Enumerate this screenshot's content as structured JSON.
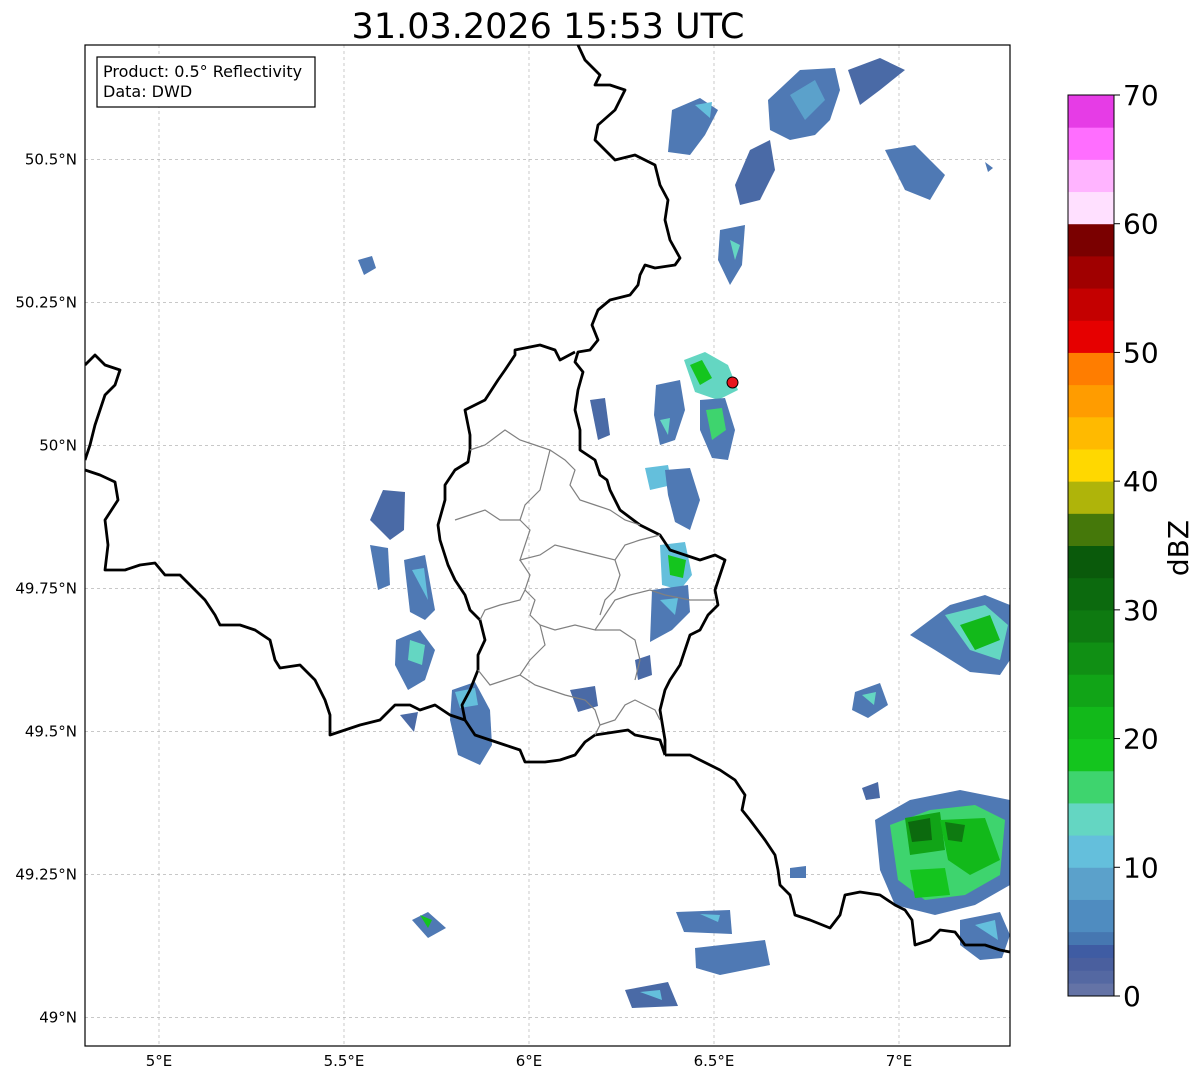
{
  "title": "31.03.2026 15:53 UTC",
  "info_box": {
    "line1": "Product: 0.5° Reflectivity",
    "line2": "Data: DWD"
  },
  "map": {
    "lon_range": [
      4.8,
      7.3
    ],
    "lat_range": [
      48.95,
      50.7
    ],
    "x_ticks": [
      {
        "value": 5.0,
        "label": "5°E"
      },
      {
        "value": 5.5,
        "label": "5.5°E"
      },
      {
        "value": 6.0,
        "label": "6°E"
      },
      {
        "value": 6.5,
        "label": "6.5°E"
      },
      {
        "value": 7.0,
        "label": "7°E"
      }
    ],
    "y_ticks": [
      {
        "value": 50.5,
        "label": "50.5°N"
      },
      {
        "value": 50.25,
        "label": "50.25°N"
      },
      {
        "value": 50.0,
        "label": "50°N"
      },
      {
        "value": 49.75,
        "label": "49.75°N"
      },
      {
        "value": 49.5,
        "label": "49.5°N"
      },
      {
        "value": 49.25,
        "label": "49.25°N"
      },
      {
        "value": 49.0,
        "label": "49°N"
      }
    ],
    "grid": true,
    "radar_site": {
      "lon": 6.55,
      "lat": 50.11,
      "color": "#e8141c"
    }
  },
  "colorbar": {
    "label": "dBZ",
    "min": 0,
    "max": 70,
    "ticks": [
      {
        "value": 0,
        "label": "0"
      },
      {
        "value": 10,
        "label": "10"
      },
      {
        "value": 20,
        "label": "20"
      },
      {
        "value": 30,
        "label": "30"
      },
      {
        "value": 40,
        "label": "40"
      },
      {
        "value": 50,
        "label": "50"
      },
      {
        "value": 60,
        "label": "60"
      },
      {
        "value": 70,
        "label": "70"
      }
    ],
    "colors": [
      "#6473a6",
      "#5468a2",
      "#4a5f9e",
      "#3f5ca3",
      "#4677b1",
      "#4f8cc0",
      "#5ba1cb",
      "#64bfdc",
      "#64d6c2",
      "#3ed46e",
      "#14c51e",
      "#12b91a",
      "#11a417",
      "#108f14",
      "#0e7a11",
      "#0c6a0e",
      "#0a5a0b",
      "#45780a",
      "#afb40a",
      "#ffd800",
      "#ffba00",
      "#ff9c00",
      "#ff7d00",
      "#e60000",
      "#c40000",
      "#a00000",
      "#7a0000",
      "#ffe0ff",
      "#ffb4ff",
      "#ff6eff",
      "#e63ce6"
    ]
  }
}
